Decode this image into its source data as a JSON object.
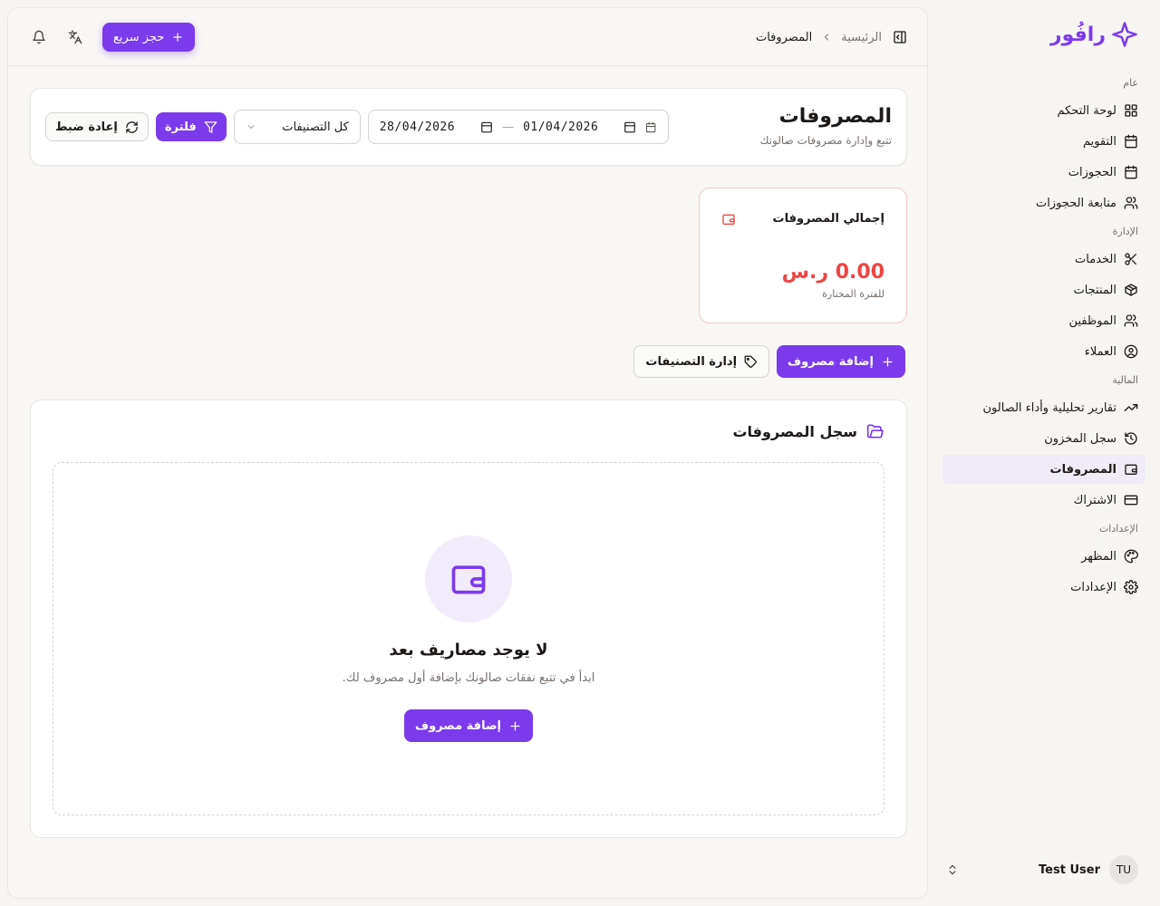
{
  "brand": {
    "name": "رافُور",
    "accent": "#7c3aed",
    "danger": "#ef4444"
  },
  "sidebar": {
    "groups": [
      {
        "label": "عام",
        "items": [
          {
            "label": "لوحة التحكم",
            "icon": "dashboard-icon"
          },
          {
            "label": "التقويم",
            "icon": "calendar-icon"
          },
          {
            "label": "الحجوزات",
            "icon": "calendar-icon"
          },
          {
            "label": "متابعة الحجوزات",
            "icon": "users-icon"
          }
        ]
      },
      {
        "label": "الإدارة",
        "items": [
          {
            "label": "الخدمات",
            "icon": "scissors-icon"
          },
          {
            "label": "المنتجات",
            "icon": "package-icon"
          },
          {
            "label": "الموظفين",
            "icon": "users-icon"
          },
          {
            "label": "العملاء",
            "icon": "user-circle-icon"
          }
        ]
      },
      {
        "label": "المالية",
        "items": [
          {
            "label": "تقارير تحليلية وأداء الصالون",
            "icon": "trending-up-icon"
          },
          {
            "label": "سجل المخزون",
            "icon": "history-icon"
          },
          {
            "label": "المصروفات",
            "icon": "wallet-icon",
            "active": true
          },
          {
            "label": "الاشتراك",
            "icon": "credit-card-icon"
          }
        ]
      },
      {
        "label": "الإعدادات",
        "items": [
          {
            "label": "المظهر",
            "icon": "palette-icon"
          },
          {
            "label": "الإعدادات",
            "icon": "gear-icon"
          }
        ]
      }
    ],
    "user": {
      "initials": "TU",
      "name": "Test User"
    }
  },
  "topbar": {
    "breadcrumb_home": "الرئيسية",
    "breadcrumb_current": "المصروفات",
    "quick_booking": "حجز سريع"
  },
  "header": {
    "title": "المصروفات",
    "subtitle": "تتبع وإدارة مصروفات صالونك",
    "date_from": "01/04/2026",
    "date_to": "28/04/2026",
    "category_select": "كل التصنيفات",
    "filter_button": "فلترة",
    "reset_button": "إعادة ضبط"
  },
  "stat": {
    "title": "إجمالي المصروفات",
    "value": "0.00 ر.س",
    "note": "للفترة المختارة"
  },
  "actions": {
    "add_expense": "إضافة مصروف",
    "manage_categories": "إدارة التصنيفات"
  },
  "log": {
    "title": "سجل المصروفات",
    "empty_title": "لا يوجد مصاريف بعد",
    "empty_subtitle": "ابدأ في تتبع نفقات صالونك بإضافة أول مصروف لك.",
    "empty_button": "إضافة مصروف"
  }
}
